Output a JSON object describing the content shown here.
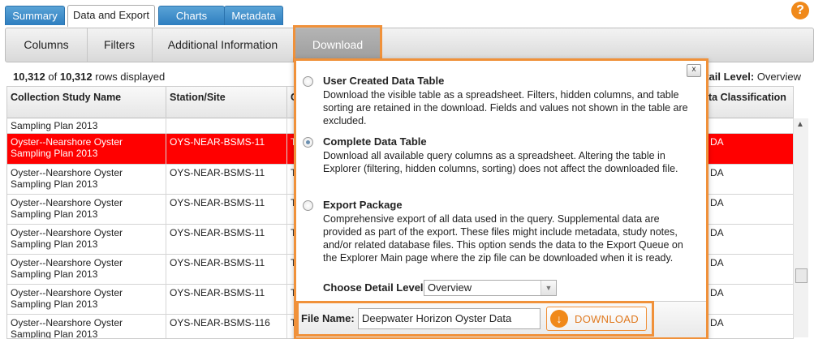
{
  "top_tabs": [
    {
      "label": "Summary"
    },
    {
      "label": "Data and Export"
    },
    {
      "label": "Charts"
    },
    {
      "label": "Metadata"
    }
  ],
  "help_icon": "?",
  "sub_tabs": [
    {
      "label": "Columns"
    },
    {
      "label": "Filters"
    },
    {
      "label": "Additional Information"
    },
    {
      "label": "Download"
    }
  ],
  "rows_info": {
    "shown": "10,312",
    "of": "of",
    "total": "10,312",
    "suffix": "rows displayed"
  },
  "detail_level_header": {
    "prefix": "tail Level:",
    "value": "Overview"
  },
  "table": {
    "headers": [
      "Collection Study Name",
      "Station/Site",
      "C",
      "ta Classification"
    ],
    "rows": [
      {
        "study": "Sampling Plan 2013",
        "station": "",
        "c": "",
        "cls": ""
      },
      {
        "study": "Oyster--Nearshore Oyster Sampling Plan 2013",
        "station": "OYS-NEAR-BSMS-11",
        "c": "T",
        "cls": "DA"
      },
      {
        "study": "Oyster--Nearshore Oyster Sampling Plan 2013",
        "station": "OYS-NEAR-BSMS-11",
        "c": "T",
        "cls": "DA"
      },
      {
        "study": "Oyster--Nearshore Oyster Sampling Plan 2013",
        "station": "OYS-NEAR-BSMS-11",
        "c": "T",
        "cls": "DA"
      },
      {
        "study": "Oyster--Nearshore Oyster Sampling Plan 2013",
        "station": "OYS-NEAR-BSMS-11",
        "c": "T",
        "cls": "DA"
      },
      {
        "study": "Oyster--Nearshore Oyster Sampling Plan 2013",
        "station": "OYS-NEAR-BSMS-11",
        "c": "T",
        "cls": "DA"
      },
      {
        "study": "Oyster--Nearshore Oyster Sampling Plan 2013",
        "station": "OYS-NEAR-BSMS-11",
        "c": "T",
        "cls": "DA"
      },
      {
        "study": "Oyster--Nearshore Oyster Sampling Plan 2013",
        "station": "OYS-NEAR-BSMS-116",
        "c": "T",
        "cls": "DA"
      }
    ]
  },
  "panel": {
    "close_label": "x",
    "options": [
      {
        "title": "User Created Data Table",
        "desc": "Download the visible table as a spreadsheet. Filters, hidden columns, and table sorting are retained in the download. Fields and values not shown in the table are excluded.",
        "checked": false
      },
      {
        "title": "Complete Data Table",
        "desc": "Download all available query columns as a spreadsheet. Altering the table in Explorer (filtering, hidden columns, sorting) does not affect the downloaded file.",
        "checked": true
      },
      {
        "title": "Export Package",
        "desc": "Comprehensive export of all data used in the query. Supplemental data are provided as part of the export. These files might include metadata, study notes, and/or related database files. This option sends the data to the Export Queue on the Explorer Main page where the zip file can be downloaded when it is ready.",
        "checked": false
      }
    ],
    "detail_label": "Choose Detail Level:",
    "detail_value": "Overview",
    "file_name_label": "File Name:",
    "file_name_value": "Deepwater Horizon Oyster Data",
    "download_button": "DOWNLOAD"
  },
  "colors": {
    "accent": "#f0913a",
    "selected_row": "#ff0000",
    "tab_blue": "#2d7ec0"
  }
}
